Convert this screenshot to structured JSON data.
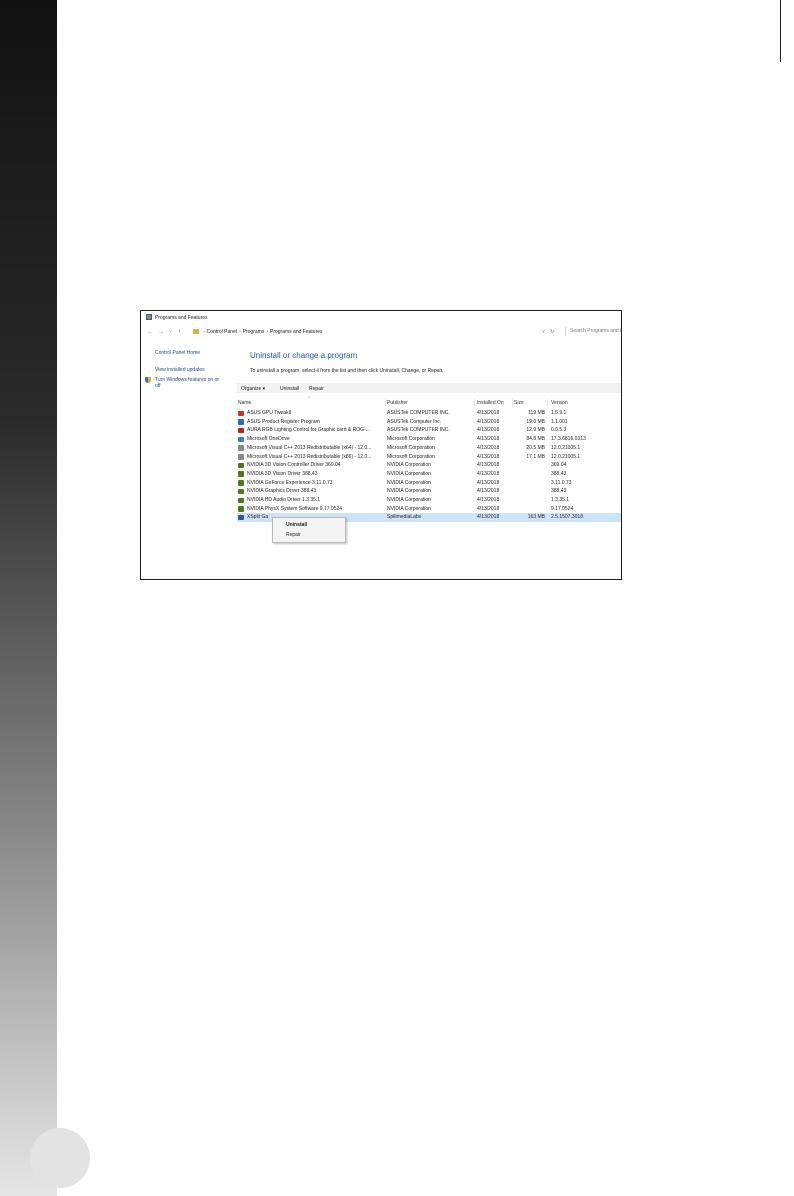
{
  "window": {
    "title": "Programs and Features"
  },
  "address": {
    "back": "←",
    "forward": "→",
    "history": "˅",
    "up": "↑",
    "crumbs": [
      "Control Panel",
      "Programs",
      "Programs and Features"
    ],
    "separator": "›",
    "dropdown": "˅",
    "refresh": "↻",
    "search_placeholder": "Search Programs and Features"
  },
  "sidebar": {
    "home": "Control Panel Home",
    "updates": "View installed updates",
    "features_line1": "Turn Windows features on or",
    "features_line2": "off"
  },
  "main": {
    "heading": "Uninstall or change a program",
    "subtitle": "To uninstall a program, select it from the list and then click Uninstall, Change, or Repair."
  },
  "toolbar": {
    "organize": "Organize ▾",
    "uninstall": "Uninstall",
    "repair": "Repair"
  },
  "table": {
    "sort_indicator": "˄",
    "headers": {
      "name": "Name",
      "publisher": "Publisher",
      "installed_on": "Installed On",
      "size": "Size",
      "version": "Version"
    },
    "rows": [
      {
        "icon": "asus-gpu-tweak-icon",
        "color": "#c0392b",
        "name": "ASUS GPU TweakII",
        "publisher": "ASUSTek COMPUTER INC.",
        "installed": "4/13/2018",
        "size": "119 MB",
        "version": "1.5.9.1"
      },
      {
        "icon": "asus-register-icon",
        "color": "#2e6cc2",
        "name": "ASUS Product Register Program",
        "publisher": "ASUSTek Computer Inc.",
        "installed": "4/13/2018",
        "size": "19.0 MB",
        "version": "1.1.001"
      },
      {
        "icon": "aura-rgb-icon",
        "color": "#b22222",
        "name": "AURA RGB Lighting Control for Graphic card & ROG-...",
        "publisher": "ASUSTek COMPUTER INC.",
        "installed": "4/13/2018",
        "size": "12.9 MB",
        "version": "0.0.5.3"
      },
      {
        "icon": "onedrive-icon",
        "color": "#2f7fd6",
        "name": "Microsoft OneDrive",
        "publisher": "Microsoft Corporation",
        "installed": "4/13/2018",
        "size": "84.8 MB",
        "version": "17.3.6816.0313"
      },
      {
        "icon": "visual-cpp-icon",
        "color": "#8a8a8a",
        "name": "Microsoft Visual C++ 2013 Redistributable (x64) - 12.0...",
        "publisher": "Microsoft Corporation",
        "installed": "4/13/2018",
        "size": "20.5 MB",
        "version": "12.0.21005.1"
      },
      {
        "icon": "visual-cpp-icon",
        "color": "#8a8a8a",
        "name": "Microsoft Visual C++ 2013 Redistributable (x86) - 12.0...",
        "publisher": "Microsoft Corporation",
        "installed": "4/13/2018",
        "size": "17.1 MB",
        "version": "12.0.21005.1"
      },
      {
        "icon": "nvidia-icon",
        "color": "#4e7a1f",
        "name": "NVIDIA 3D Vision Controller Driver 369.04",
        "publisher": "NVIDIA Corporation",
        "installed": "4/13/2018",
        "size": "",
        "version": "369.04"
      },
      {
        "icon": "nvidia-icon",
        "color": "#4e7a1f",
        "name": "NVIDIA 3D Vision Driver 388.43",
        "publisher": "NVIDIA Corporation",
        "installed": "4/13/2018",
        "size": "",
        "version": "388.43"
      },
      {
        "icon": "nvidia-icon",
        "color": "#4e7a1f",
        "name": "NVIDIA GeForce Experience 3.11.0.73",
        "publisher": "NVIDIA Corporation",
        "installed": "4/13/2018",
        "size": "",
        "version": "3.11.0.73"
      },
      {
        "icon": "nvidia-icon",
        "color": "#4e7a1f",
        "name": "NVIDIA Graphics Driver 388.43",
        "publisher": "NVIDIA Corporation",
        "installed": "4/13/2018",
        "size": "",
        "version": "388.43"
      },
      {
        "icon": "nvidia-icon",
        "color": "#4e7a1f",
        "name": "NVIDIA HD Audio Driver 1.3.35.1",
        "publisher": "NVIDIA Corporation",
        "installed": "4/13/2018",
        "size": "",
        "version": "1.3.35.1"
      },
      {
        "icon": "nvidia-icon",
        "color": "#4e7a1f",
        "name": "NVIDIA PhysX System Software 9.17.0524",
        "publisher": "NVIDIA Corporation",
        "installed": "4/13/2018",
        "size": "",
        "version": "9.17.0524"
      },
      {
        "icon": "xsplit-icon",
        "color": "#2c5aa0",
        "name": "XSplit Ga",
        "publisher": "SplitmediaLabs",
        "installed": "4/13/2018",
        "size": "163 MB",
        "version": "2.5.1507.3018",
        "selected": true
      }
    ]
  },
  "context_menu": {
    "items": [
      "Uninstall",
      "Repair"
    ]
  }
}
